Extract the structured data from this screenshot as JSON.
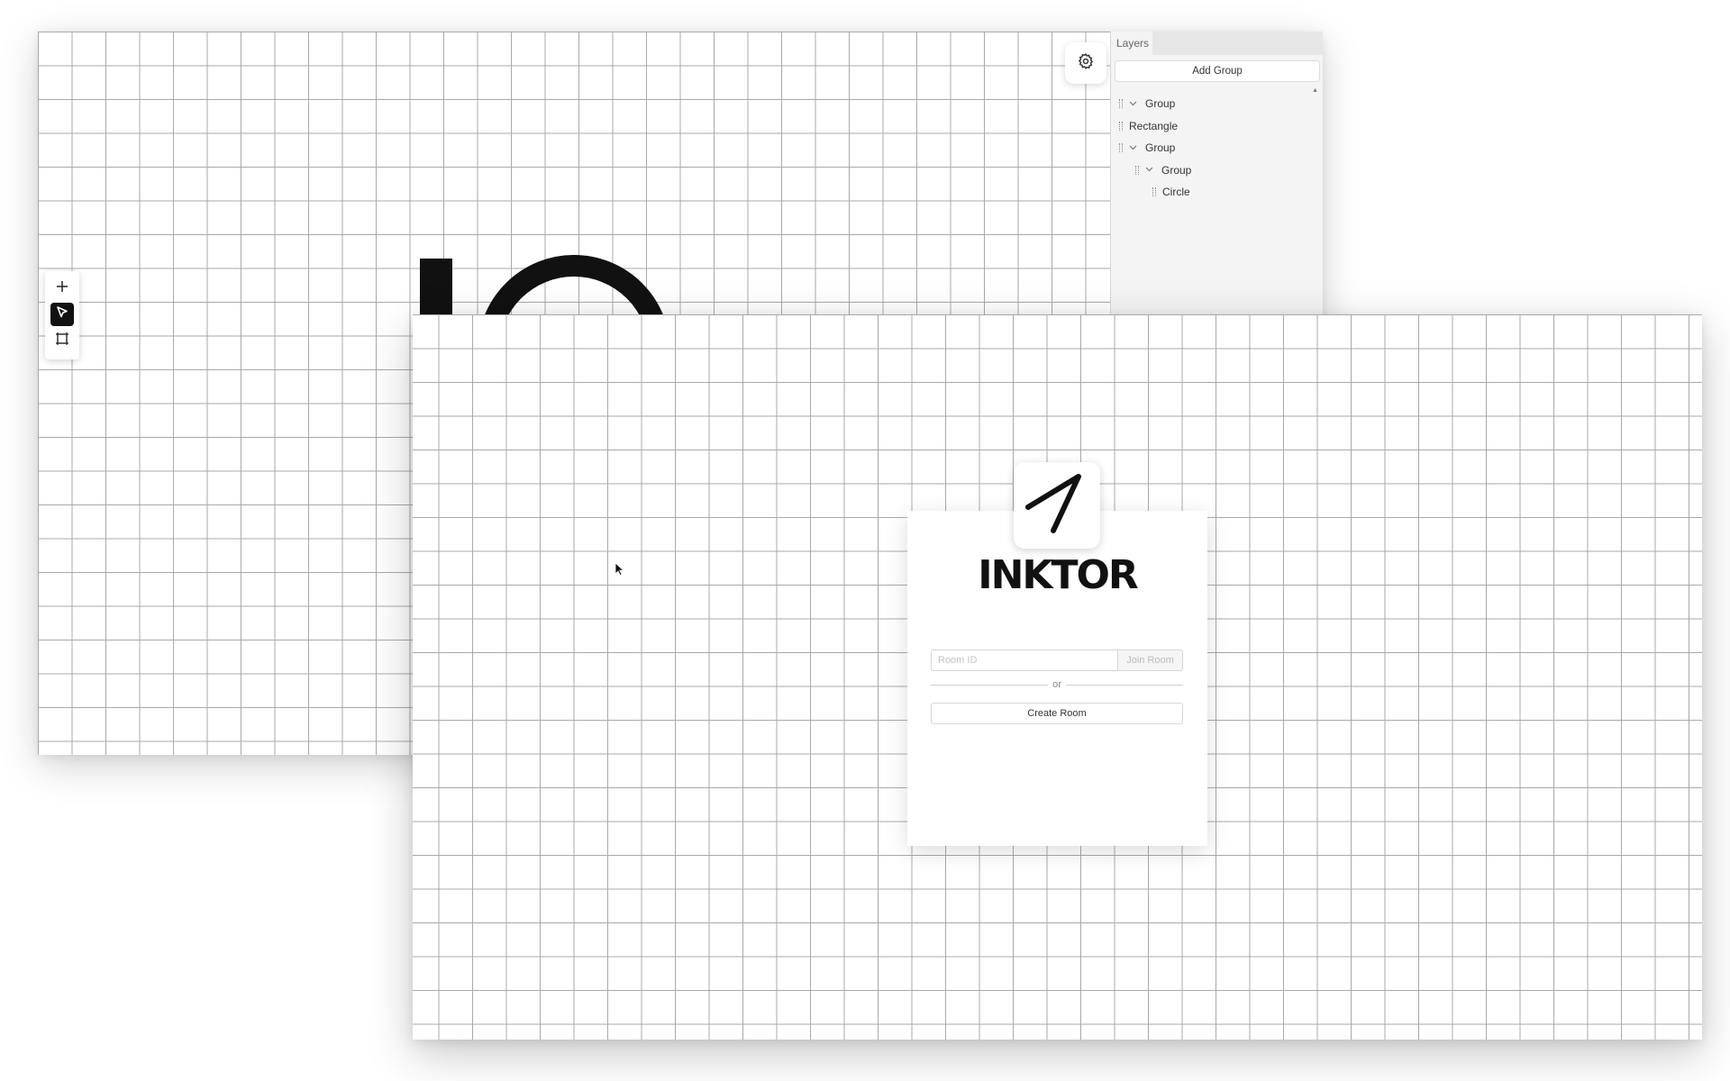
{
  "back_window": {
    "icons": {
      "settings": "gear-icon",
      "add_tool": "plus-icon",
      "select_tool": "cursor-arrow-icon",
      "frame_tool": "frame-square-icon"
    },
    "layers_panel": {
      "tab_label": "Layers",
      "add_group_label": "Add Group",
      "items": [
        {
          "label": "Group",
          "depth": 0,
          "expandable": true
        },
        {
          "label": "Rectangle",
          "depth": 0,
          "expandable": false
        },
        {
          "label": "Group",
          "depth": 0,
          "expandable": true
        },
        {
          "label": "Group",
          "depth": 1,
          "expandable": true
        },
        {
          "label": "Circle",
          "depth": 2,
          "expandable": false
        }
      ]
    }
  },
  "front_window": {
    "brand": "INKTOR",
    "logo_icon": "pen-stroke-logo-icon",
    "room_id_placeholder": "Room ID",
    "join_room_label": "Join Room",
    "divider_text": "or",
    "create_room_label": "Create Room"
  },
  "colors": {
    "grid_line": "#a9a9a9",
    "ink": "#111111",
    "active_tool_bg": "#111111"
  }
}
